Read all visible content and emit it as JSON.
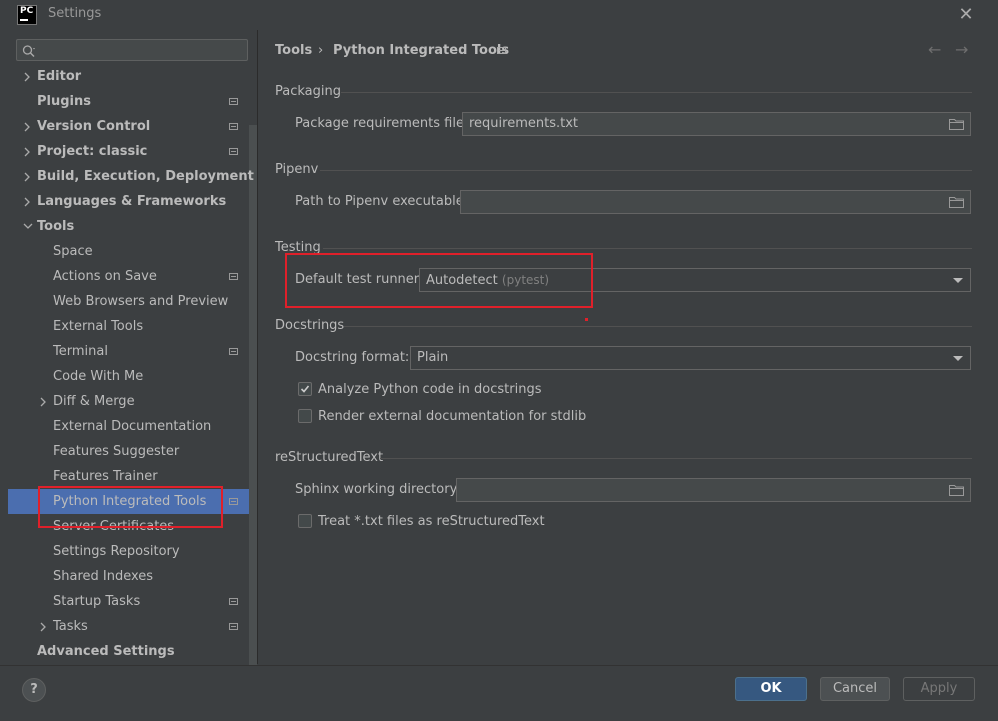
{
  "window": {
    "title": "Settings",
    "logo_text": "PC"
  },
  "search": {
    "placeholder": ""
  },
  "sidebar": {
    "items": [
      {
        "label": "Editor",
        "bold": true,
        "expander": "collapsed",
        "project": false
      },
      {
        "label": "Plugins",
        "bold": true,
        "expander": "none",
        "project": true
      },
      {
        "label": "Version Control",
        "bold": true,
        "expander": "collapsed",
        "project": true
      },
      {
        "label": "Project: classic",
        "bold": true,
        "expander": "collapsed",
        "project": true
      },
      {
        "label": "Build, Execution, Deployment",
        "bold": true,
        "expander": "collapsed",
        "project": false
      },
      {
        "label": "Languages & Frameworks",
        "bold": true,
        "expander": "collapsed",
        "project": false
      },
      {
        "label": "Tools",
        "bold": true,
        "expander": "expanded",
        "project": false
      },
      {
        "label": "Space",
        "bold": false,
        "expander": "none",
        "project": false
      },
      {
        "label": "Actions on Save",
        "bold": false,
        "expander": "none",
        "project": true
      },
      {
        "label": "Web Browsers and Preview",
        "bold": false,
        "expander": "none",
        "project": false
      },
      {
        "label": "External Tools",
        "bold": false,
        "expander": "none",
        "project": false
      },
      {
        "label": "Terminal",
        "bold": false,
        "expander": "none",
        "project": true
      },
      {
        "label": "Code With Me",
        "bold": false,
        "expander": "none",
        "project": false
      },
      {
        "label": "Diff & Merge",
        "bold": false,
        "expander": "collapsed",
        "project": false
      },
      {
        "label": "External Documentation",
        "bold": false,
        "expander": "none",
        "project": false
      },
      {
        "label": "Features Suggester",
        "bold": false,
        "expander": "none",
        "project": false
      },
      {
        "label": "Features Trainer",
        "bold": false,
        "expander": "none",
        "project": false
      },
      {
        "label": "Python Integrated Tools",
        "bold": false,
        "expander": "none",
        "project": true,
        "selected": true
      },
      {
        "label": "Server Certificates",
        "bold": false,
        "expander": "none",
        "project": false
      },
      {
        "label": "Settings Repository",
        "bold": false,
        "expander": "none",
        "project": false
      },
      {
        "label": "Shared Indexes",
        "bold": false,
        "expander": "none",
        "project": false
      },
      {
        "label": "Startup Tasks",
        "bold": false,
        "expander": "none",
        "project": true
      },
      {
        "label": "Tasks",
        "bold": false,
        "expander": "collapsed",
        "project": true
      },
      {
        "label": "Advanced Settings",
        "bold": true,
        "expander": "none",
        "project": false
      }
    ]
  },
  "breadcrumb": {
    "parent": "Tools",
    "separator": "›",
    "current": "Python Integrated Tools"
  },
  "packaging": {
    "title": "Packaging",
    "requirements_label": "Package requirements file:",
    "requirements_value": "requirements.txt"
  },
  "pipenv": {
    "title": "Pipenv",
    "path_label": "Path to Pipenv executable:",
    "path_value": ""
  },
  "testing": {
    "title": "Testing",
    "runner_label": "Default test runner:",
    "runner_value": "Autodetect",
    "runner_hint": "(pytest)"
  },
  "docstrings": {
    "title": "Docstrings",
    "format_label": "Docstring format:",
    "format_value": "Plain",
    "analyze_label": "Analyze Python code in docstrings",
    "analyze_checked": true,
    "render_label": "Render external documentation for stdlib",
    "render_checked": false
  },
  "rst": {
    "title": "reStructuredText",
    "sphinx_label": "Sphinx working directory:",
    "sphinx_value": "",
    "treat_label": "Treat *.txt files as reStructuredText",
    "treat_checked": false
  },
  "footer": {
    "help": "?",
    "ok": "OK",
    "cancel": "Cancel",
    "apply": "Apply"
  },
  "colors": {
    "accent": "#4b6eaf",
    "highlight": "#e0202a",
    "background": "#3c3f41"
  }
}
